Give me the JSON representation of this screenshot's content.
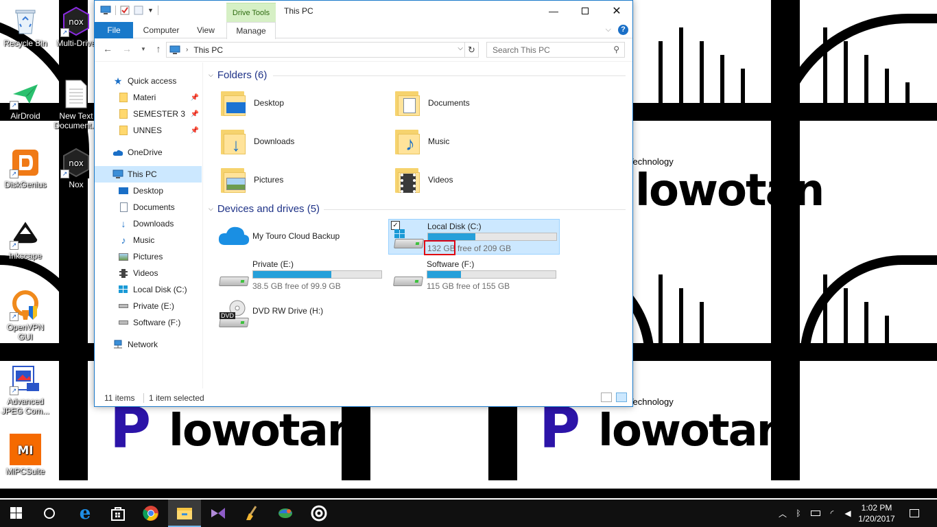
{
  "wallpaper": {
    "brand_text": "lowotan",
    "brand_letter": "P",
    "small_text": "Technology"
  },
  "desktop_icons": [
    {
      "name": "recycle-bin",
      "label": "Recycle Bin"
    },
    {
      "name": "multi-drive",
      "label": "Multi-Drive"
    },
    {
      "name": "airdroid",
      "label": "AirDroid"
    },
    {
      "name": "new-text-document",
      "label": "New Text Document..."
    },
    {
      "name": "diskgenius",
      "label": "DiskGenius"
    },
    {
      "name": "nox",
      "label": "Nox"
    },
    {
      "name": "inkscape",
      "label": "Inkscape"
    },
    {
      "name": "openvpn-gui",
      "label": "OpenVPN GUI"
    },
    {
      "name": "advanced-jpeg",
      "label": "Advanced JPEG Com..."
    },
    {
      "name": "mipcsuite",
      "label": "MiPCSuite"
    }
  ],
  "explorer": {
    "title": "This PC",
    "context_tab": "Drive Tools",
    "tabs": {
      "file": "File",
      "computer": "Computer",
      "view": "View",
      "manage": "Manage"
    },
    "address": {
      "crumb": "This PC"
    },
    "search": {
      "placeholder": "Search This PC"
    },
    "nav": {
      "quick_access": "Quick access",
      "pinned": [
        "Materi",
        "SEMESTER 3",
        "UNNES"
      ],
      "onedrive": "OneDrive",
      "this_pc": "This PC",
      "pc_items": [
        "Desktop",
        "Documents",
        "Downloads",
        "Music",
        "Pictures",
        "Videos",
        "Local Disk (C:)",
        "Private (E:)",
        "Software (F:)"
      ],
      "network": "Network"
    },
    "folders_header": "Folders (6)",
    "folders": [
      "Desktop",
      "Documents",
      "Downloads",
      "Music",
      "Pictures",
      "Videos"
    ],
    "devices_header": "Devices and drives (5)",
    "drives": {
      "cloud": {
        "name": "My Touro Cloud Backup"
      },
      "c": {
        "name": "Local Disk (C:)",
        "free": "132 GB",
        "free_rest": " free of 209 GB",
        "used_fraction": 0.37
      },
      "e": {
        "name": "Private (E:)",
        "free_text": "38.5 GB free of 99.9 GB",
        "used_fraction": 0.61
      },
      "f": {
        "name": "Software (F:)",
        "free_text": "115 GB free of 155 GB",
        "used_fraction": 0.26
      },
      "h": {
        "name": "DVD RW Drive (H:)",
        "badge": "DVD"
      }
    },
    "status": {
      "items": "11 items",
      "selected": "1 item selected"
    }
  },
  "taskbar": {
    "clock_time": "1:02 PM",
    "clock_date": "1/20/2017"
  },
  "colors": {
    "accent": "#1979ca",
    "selection": "#cce8ff",
    "drive_fill": "#26a0da",
    "highlight": "#e0000f"
  }
}
